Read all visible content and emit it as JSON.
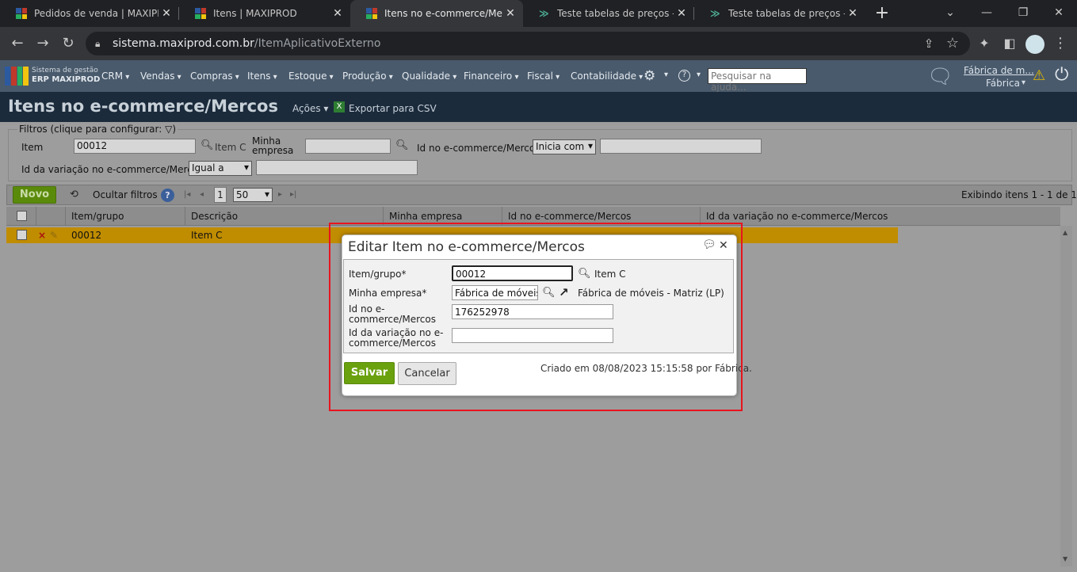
{
  "browser": {
    "tabs": [
      {
        "title": "Pedidos de venda | MAXIPROD",
        "icon": "maxiprod-logo",
        "active": false
      },
      {
        "title": "Itens | MAXIPROD",
        "icon": "maxiprod-logo",
        "active": false
      },
      {
        "title": "Itens no e-commerce/Mercos",
        "icon": "maxiprod-logo",
        "active": true
      },
      {
        "title": "Teste tabelas de preços - MX",
        "icon": "mercos-logo",
        "active": false
      },
      {
        "title": "Teste tabelas de preços - MX",
        "icon": "mercos-logo",
        "active": false
      }
    ],
    "url_host": "sistema.maxiprod.com.br",
    "url_path": "/ItemAplicativoExterno"
  },
  "app": {
    "brand_line1": "Sistema de gestão",
    "brand_line2": "ERP MAXIPROD",
    "menu": [
      "CRM",
      "Vendas",
      "Compras",
      "Itens",
      "Estoque",
      "Produção",
      "Qualidade",
      "Financeiro",
      "Fiscal",
      "Contabilidade"
    ],
    "help_search_placeholder": "Pesquisar na ajuda...",
    "company_link": "Fábrica de m...",
    "user": "Fábrica"
  },
  "page": {
    "title": "Itens no e-commerce/Mercos",
    "actions_label": "Ações",
    "export_label": "Exportar para CSV"
  },
  "filters": {
    "legend": "Filtros (clique para configurar:",
    "item_label": "Item",
    "item_value": "00012",
    "item_desc": "Item C",
    "empresa_label_1": "Minha",
    "empresa_label_2": "empresa",
    "empresa_value": "",
    "idmercos_label": "Id no e-commerce/Mercos",
    "idmercos_op": "Inicia com",
    "idmercos_value": "",
    "variacao_label": "Id da variação no e-commerce/Mercos",
    "variacao_op": "Igual a",
    "variacao_value": ""
  },
  "toolbar": {
    "new_label": "Novo",
    "hide_filters_label": "Ocultar filtros",
    "page": "1",
    "page_size": "50",
    "summary": "Exibindo itens 1 - 1 de 1"
  },
  "grid": {
    "columns": [
      "Item/grupo",
      "Descrição",
      "Minha empresa",
      "Id no e-commerce/Mercos",
      "Id da variação no e-commerce/Mercos"
    ],
    "rows": [
      {
        "item": "00012",
        "descricao": "Item C"
      }
    ]
  },
  "dialog": {
    "title": "Editar Item no e-commerce/Mercos",
    "item_label": "Item/grupo*",
    "item_value": "00012",
    "item_desc": "Item C",
    "empresa_label": "Minha empresa*",
    "empresa_value": "Fábrica de móveis -",
    "empresa_desc": "Fábrica de móveis - Matriz (LP)",
    "idmercos_label_1": "Id no e-",
    "idmercos_label_2": "commerce/Mercos",
    "idmercos_value": "176252978",
    "variacao_label_1": "Id da variação no e-",
    "variacao_label_2": "commerce/Mercos",
    "variacao_value": "",
    "save_label": "Salvar",
    "cancel_label": "Cancelar",
    "created_info": "Criado em 08/08/2023 15:15:58 por Fábrica."
  },
  "colors": {
    "accent_green": "#6aa10e",
    "row_highlight": "#c08c00",
    "header_blue": "#495a6c",
    "title_dark": "#1b2b3c",
    "annotation_red": "#e8141e"
  }
}
